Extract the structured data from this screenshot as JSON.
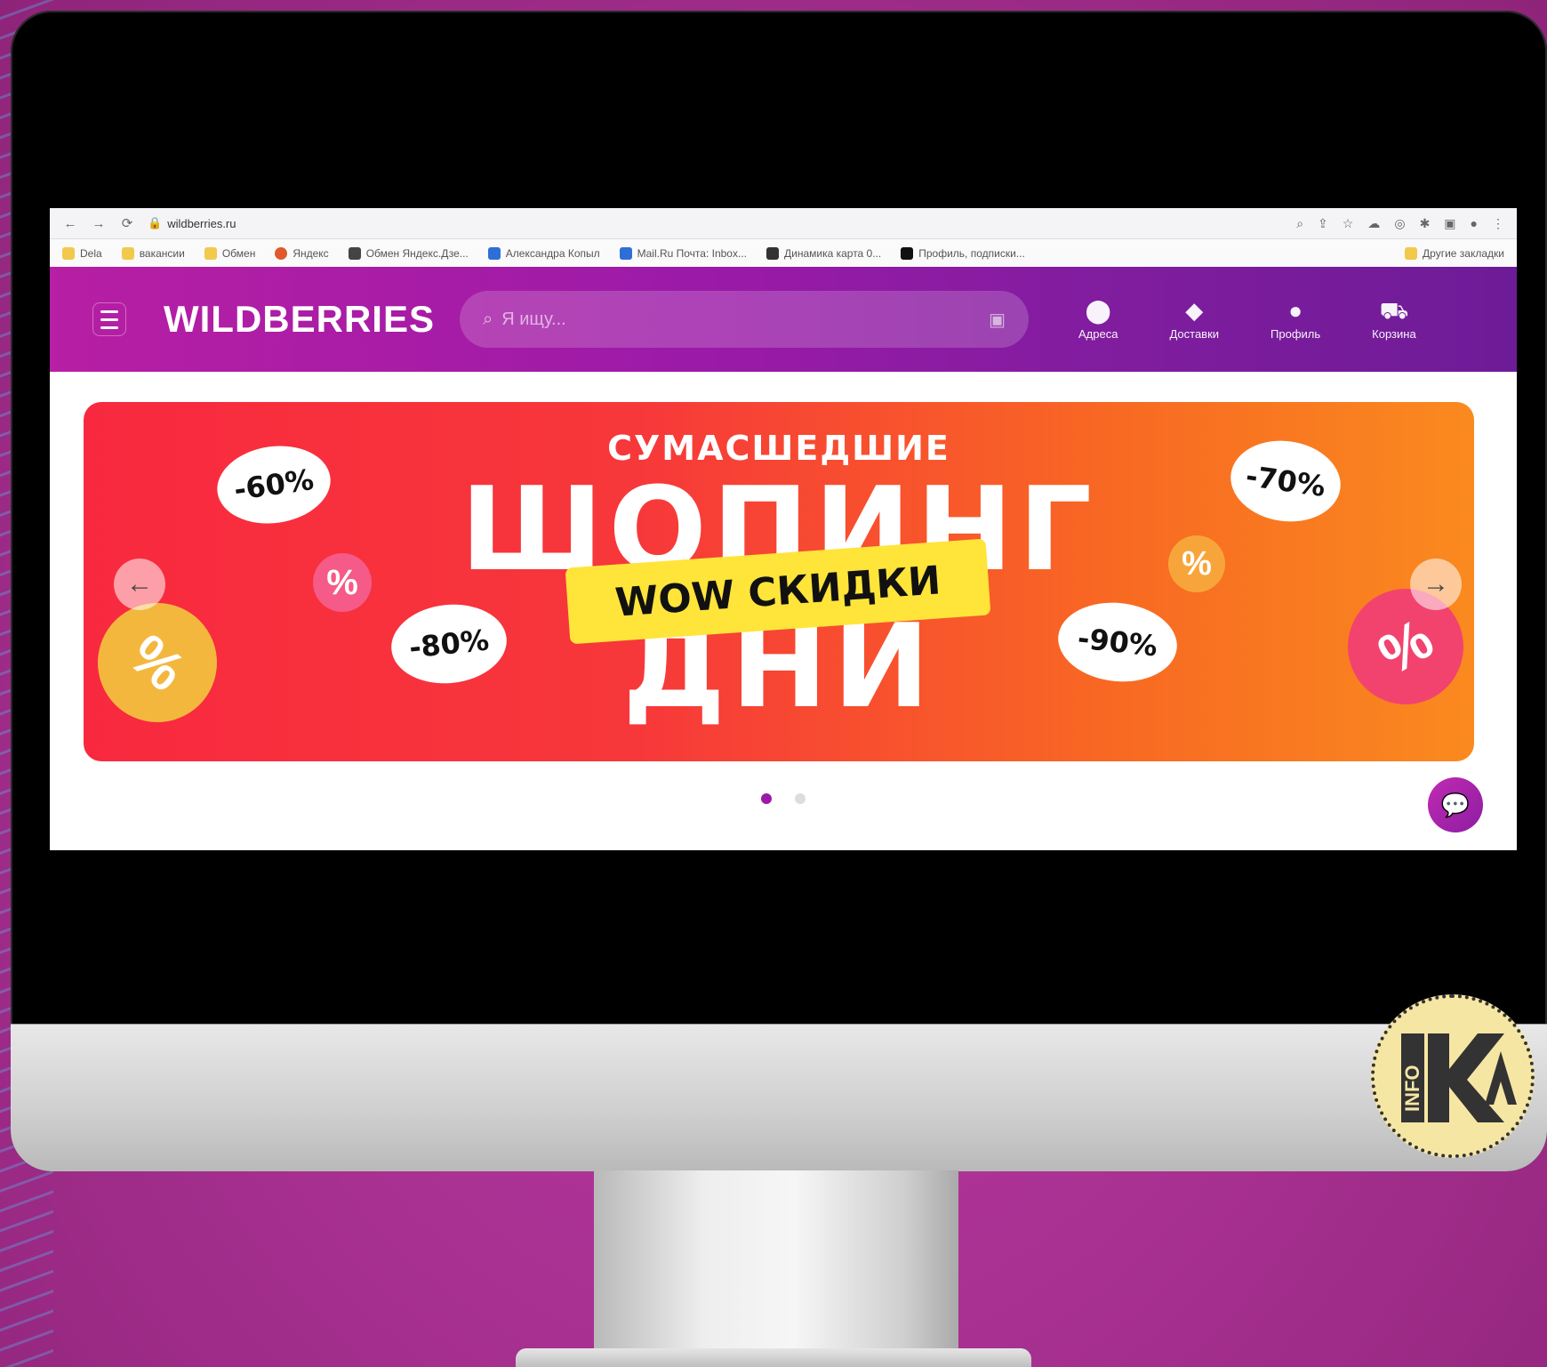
{
  "browser": {
    "url": "wildberries.ru",
    "bookmarks": [
      {
        "label": "Dela",
        "color": "#f2c94c"
      },
      {
        "label": "вакансии",
        "color": "#f2c94c"
      },
      {
        "label": "Обмен",
        "color": "#f2c94c"
      },
      {
        "label": "Яндекс",
        "color": "#e0592a"
      },
      {
        "label": "Обмен Яндекс.Дзе...",
        "color": "#444444"
      },
      {
        "label": "Александра Копыл",
        "color": "#2d6fd6"
      },
      {
        "label": "Mail.Ru Почта: Inbox...",
        "color": "#2d6fd6"
      },
      {
        "label": "Динамика карта 0...",
        "color": "#333333"
      },
      {
        "label": "Профиль, подписки...",
        "color": "#111111"
      },
      {
        "label": "Другие закладки",
        "color": "#f2c94c"
      }
    ]
  },
  "site": {
    "logo": "WILDBERRIES",
    "search_placeholder": "Я ищу...",
    "nav": [
      {
        "label": "Адреса",
        "icon": "location-pin-icon",
        "glyph": "⬤"
      },
      {
        "label": "Доставки",
        "icon": "box-icon",
        "glyph": "◆"
      },
      {
        "label": "Профиль",
        "icon": "user-icon",
        "glyph": "●"
      },
      {
        "label": "Корзина",
        "icon": "cart-icon",
        "glyph": "🛒"
      }
    ]
  },
  "banner": {
    "title_small": "СУМАСШЕДШИЕ",
    "title_big": "ШОПИНГ",
    "title_big2": "ДНИ",
    "sticker": "WOW СКИДКИ",
    "bubbles": [
      "-60%",
      "-70%",
      "-80%",
      "-90%"
    ],
    "percent_glyph": "%",
    "prev_arrow": "←",
    "next_arrow": "→",
    "active_slide": 1,
    "slides": 2
  },
  "chat_icon_glyph": "💬",
  "watermark": {
    "text_info": "INFO",
    "text_ka": "KA"
  },
  "colors": {
    "brand_purple": "#9b1aa8",
    "banner_red": "#f8293f",
    "banner_orange": "#fa8a1f",
    "sticker_yellow": "#ffe43a",
    "background_magenta": "#a52f8f"
  }
}
